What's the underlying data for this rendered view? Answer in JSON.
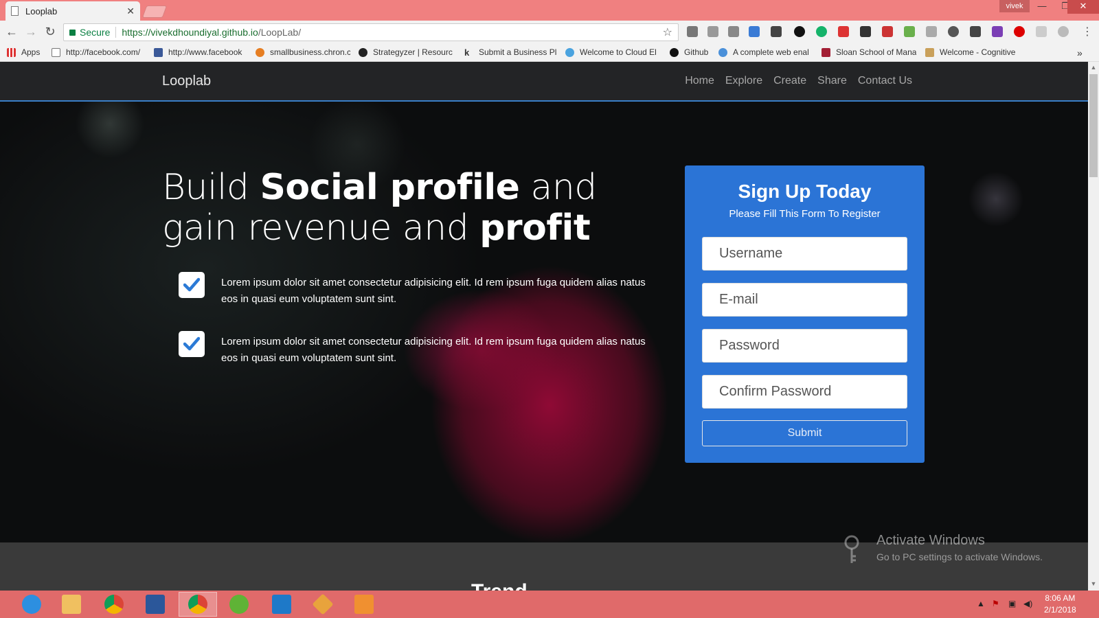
{
  "browser": {
    "tab_title": "Looplab",
    "user": "vivek",
    "address": {
      "secure_label": "Secure",
      "url_host": "https://vivekdhoundiyal.github.io",
      "url_path": "/LoopLab/"
    },
    "bookmarks": [
      {
        "label": "Apps"
      },
      {
        "label": "http://facebook.com/"
      },
      {
        "label": "http://www.facebook"
      },
      {
        "label": "smallbusiness.chron.c"
      },
      {
        "label": "Strategyzer | Resourc"
      },
      {
        "label": "Submit a Business Pla"
      },
      {
        "label": "Welcome to Cloud El"
      },
      {
        "label": "Github"
      },
      {
        "label": "A complete web enal"
      },
      {
        "label": "Sloan School of Mana"
      },
      {
        "label": "Welcome - Cognitive"
      }
    ],
    "overflow": "»"
  },
  "site": {
    "brand": "Looplab",
    "nav": [
      "Home",
      "Explore",
      "Create",
      "Share",
      "Contact Us"
    ],
    "headline": {
      "part1": "Build ",
      "bold1": "Social profile",
      "part2": " and gain revenue and ",
      "bold2": "profit"
    },
    "features": [
      "Lorem ipsum dolor sit amet consectetur adipisicing elit. Id rem ipsum fuga quidem alias natus eos in quasi eum voluptatem sunt sint.",
      "Lorem ipsum dolor sit amet consectetur adipisicing elit. Id rem ipsum fuga quidem alias natus eos in quasi eum voluptatem sunt sint."
    ],
    "signup": {
      "title": "Sign Up Today",
      "subtitle": "Please Fill This Form To Register",
      "username_placeholder": "Username",
      "email_placeholder": "E-mail",
      "password_placeholder": "Password",
      "confirm_placeholder": "Confirm Password",
      "submit_label": "Submit"
    },
    "bottom_title": "Trend"
  },
  "watermark": {
    "title": "Activate Windows",
    "subtitle": "Go to PC settings to activate Windows."
  },
  "taskbar": {
    "time": "8:06 AM",
    "date": "2/1/2018"
  },
  "colors": {
    "accent": "#2b74d6",
    "nav_bg": "#232426",
    "tabbar": "#f08080",
    "taskbar": "#e06a6a"
  }
}
